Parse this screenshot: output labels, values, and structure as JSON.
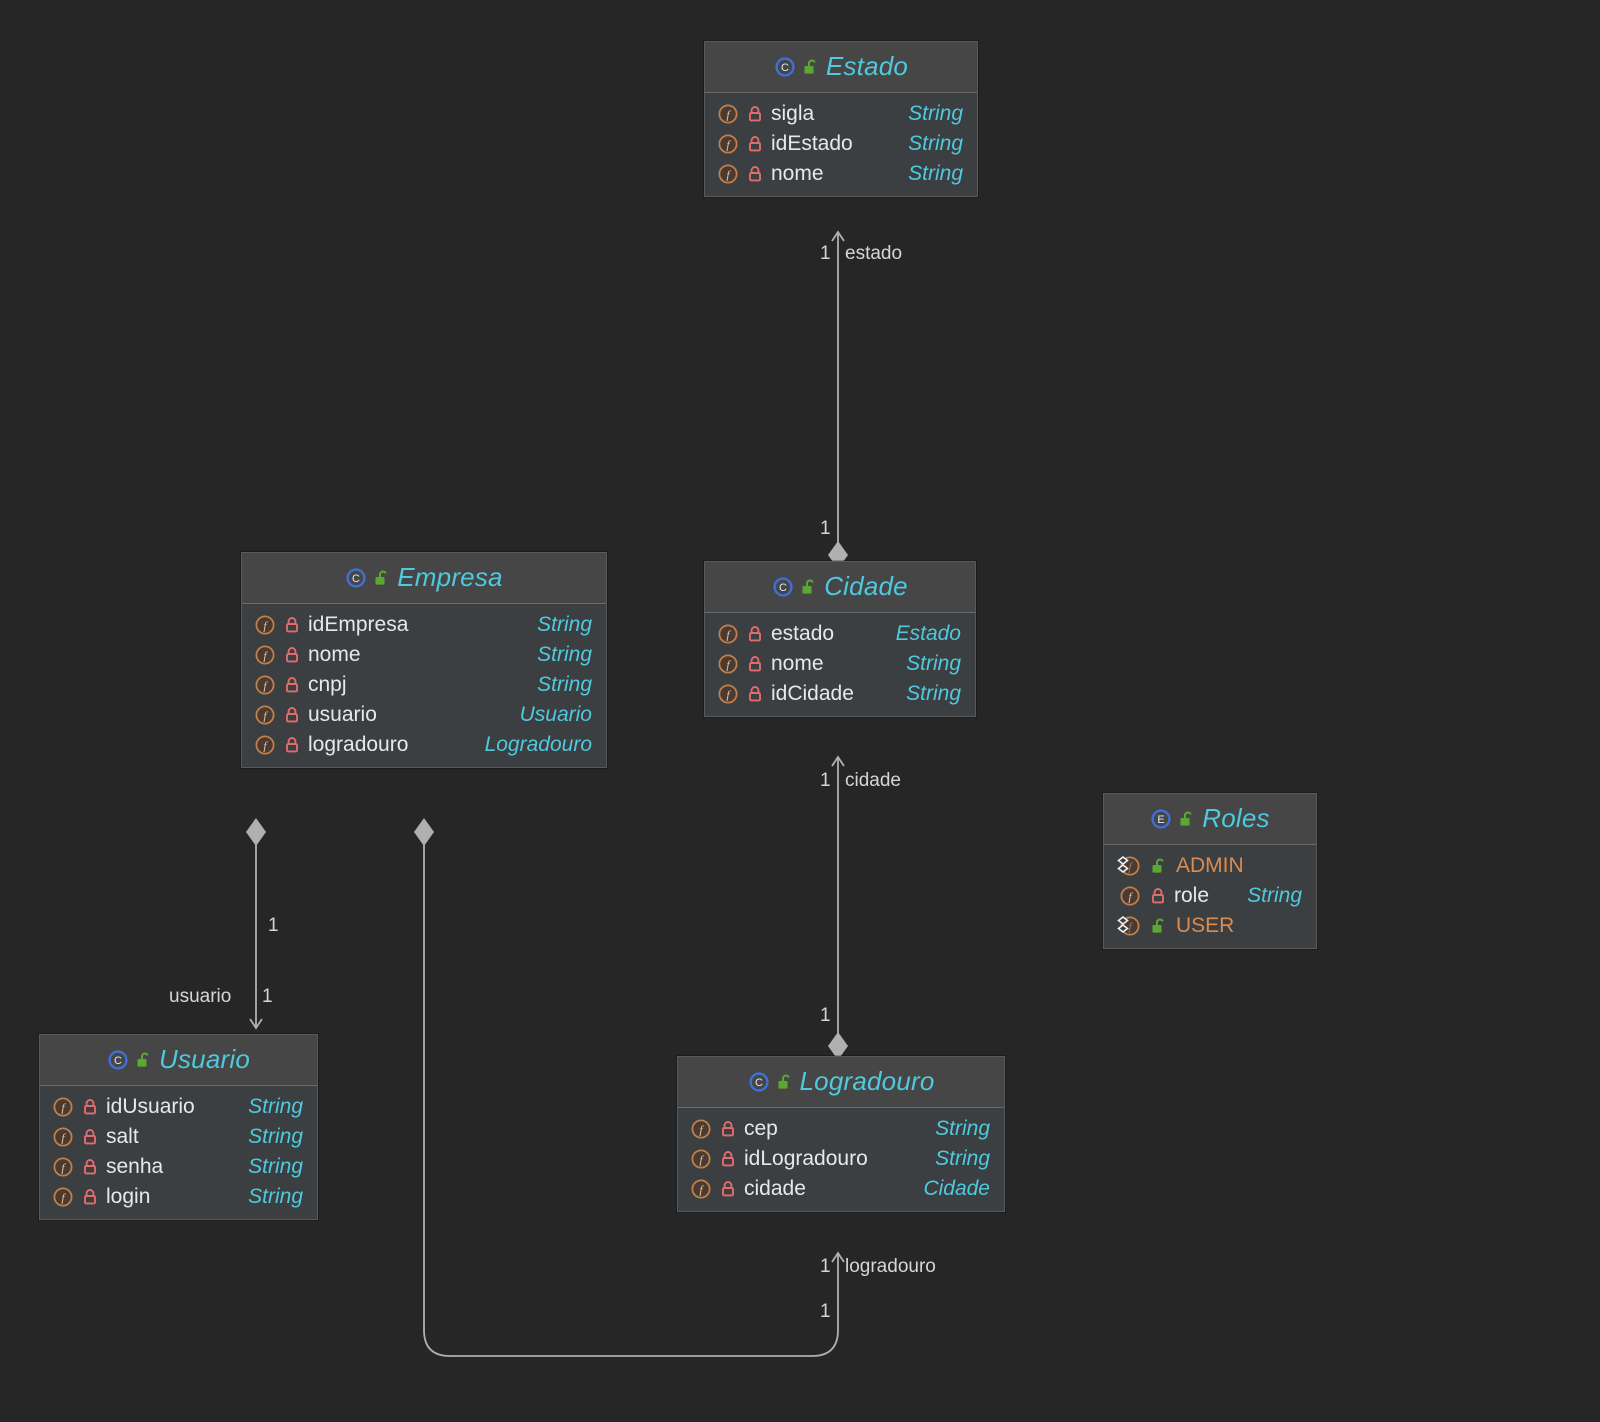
{
  "diagram": {
    "title": "UML Class Diagram",
    "background_color": "#262626",
    "box_background": "#3c3f41",
    "header_background": "#464646",
    "type_color": "#4ec9dd",
    "name_color": "#e8e8e8",
    "enum_constant_color": "#d98b50",
    "edge_color": "#b0b0b0"
  },
  "classes": [
    {
      "id": "estado",
      "name": "Estado",
      "stereotype_icon": "class-icon",
      "visibility_icon": "unlock-icon",
      "members": [
        {
          "icon": "field-icon",
          "lock": "lock-closed-icon",
          "name": "sigla",
          "type": "String"
        },
        {
          "icon": "field-icon",
          "lock": "lock-closed-icon",
          "name": "idEstado",
          "type": "String"
        },
        {
          "icon": "field-icon",
          "lock": "lock-closed-icon",
          "name": "nome",
          "type": "String"
        }
      ]
    },
    {
      "id": "empresa",
      "name": "Empresa",
      "stereotype_icon": "class-icon",
      "visibility_icon": "unlock-icon",
      "members": [
        {
          "icon": "field-icon",
          "lock": "lock-closed-icon",
          "name": "idEmpresa",
          "type": "String"
        },
        {
          "icon": "field-icon",
          "lock": "lock-closed-icon",
          "name": "nome",
          "type": "String"
        },
        {
          "icon": "field-icon",
          "lock": "lock-closed-icon",
          "name": "cnpj",
          "type": "String"
        },
        {
          "icon": "field-icon",
          "lock": "lock-closed-icon",
          "name": "usuario",
          "type": "Usuario"
        },
        {
          "icon": "field-icon",
          "lock": "lock-closed-icon",
          "name": "logradouro",
          "type": "Logradouro"
        }
      ]
    },
    {
      "id": "cidade",
      "name": "Cidade",
      "stereotype_icon": "class-icon",
      "visibility_icon": "unlock-icon",
      "members": [
        {
          "icon": "field-icon",
          "lock": "lock-closed-icon",
          "name": "estado",
          "type": "Estado"
        },
        {
          "icon": "field-icon",
          "lock": "lock-closed-icon",
          "name": "nome",
          "type": "String"
        },
        {
          "icon": "field-icon",
          "lock": "lock-closed-icon",
          "name": "idCidade",
          "type": "String"
        }
      ]
    },
    {
      "id": "roles",
      "name": "Roles",
      "stereotype_icon": "enum-icon",
      "visibility_icon": "unlock-icon",
      "members": [
        {
          "icon": "enum-constant-icon",
          "lock": "unlock-icon",
          "name": "ADMIN",
          "type": ""
        },
        {
          "icon": "field-icon",
          "lock": "lock-closed-icon",
          "name": "role",
          "type": "String"
        },
        {
          "icon": "enum-constant-icon",
          "lock": "unlock-icon",
          "name": "USER",
          "type": ""
        }
      ]
    },
    {
      "id": "usuario",
      "name": "Usuario",
      "stereotype_icon": "class-icon",
      "visibility_icon": "unlock-icon",
      "members": [
        {
          "icon": "field-icon",
          "lock": "lock-closed-icon",
          "name": "idUsuario",
          "type": "String"
        },
        {
          "icon": "field-icon",
          "lock": "lock-closed-icon",
          "name": "salt",
          "type": "String"
        },
        {
          "icon": "field-icon",
          "lock": "lock-closed-icon",
          "name": "senha",
          "type": "String"
        },
        {
          "icon": "field-icon",
          "lock": "lock-closed-icon",
          "name": "login",
          "type": "String"
        }
      ]
    },
    {
      "id": "logradouro",
      "name": "Logradouro",
      "stereotype_icon": "class-icon",
      "visibility_icon": "unlock-icon",
      "members": [
        {
          "icon": "field-icon",
          "lock": "lock-closed-icon",
          "name": "cep",
          "type": "String"
        },
        {
          "icon": "field-icon",
          "lock": "lock-closed-icon",
          "name": "idLogradouro",
          "type": "String"
        },
        {
          "icon": "field-icon",
          "lock": "lock-closed-icon",
          "name": "cidade",
          "type": "Cidade"
        }
      ]
    }
  ],
  "relations": [
    {
      "id": "cidade-estado",
      "from": "Cidade",
      "to": "Estado",
      "source_multiplicity": "1",
      "target_multiplicity": "1",
      "role": "estado",
      "source_decoration": "filled-diamond",
      "target_decoration": "open-arrow"
    },
    {
      "id": "logradouro-cidade",
      "from": "Logradouro",
      "to": "Cidade",
      "source_multiplicity": "1",
      "target_multiplicity": "1",
      "role": "cidade",
      "source_decoration": "filled-diamond",
      "target_decoration": "open-arrow"
    },
    {
      "id": "empresa-usuario",
      "from": "Empresa",
      "to": "Usuario",
      "source_multiplicity": "1",
      "target_multiplicity": "1",
      "role": "usuario",
      "source_decoration": "filled-diamond",
      "target_decoration": "open-arrow"
    },
    {
      "id": "empresa-logradouro",
      "from": "Empresa",
      "to": "Logradouro",
      "source_multiplicity": "1",
      "target_multiplicity": "1",
      "role": "logradouro",
      "source_decoration": "filled-diamond",
      "target_decoration": "open-arrow"
    }
  ],
  "edge_labels": {
    "estado_mult": "1",
    "estado_role": "estado",
    "cidade_src_mult": "1",
    "cidade_mult": "1",
    "cidade_role": "cidade",
    "logradouro_src_mult": "1",
    "usuario_top_mult": "1",
    "usuario_role": "usuario",
    "usuario_mult": "1",
    "logradouro_mult": "1",
    "logradouro_role": "logradouro",
    "logradouro_bottom_mult": "1"
  }
}
